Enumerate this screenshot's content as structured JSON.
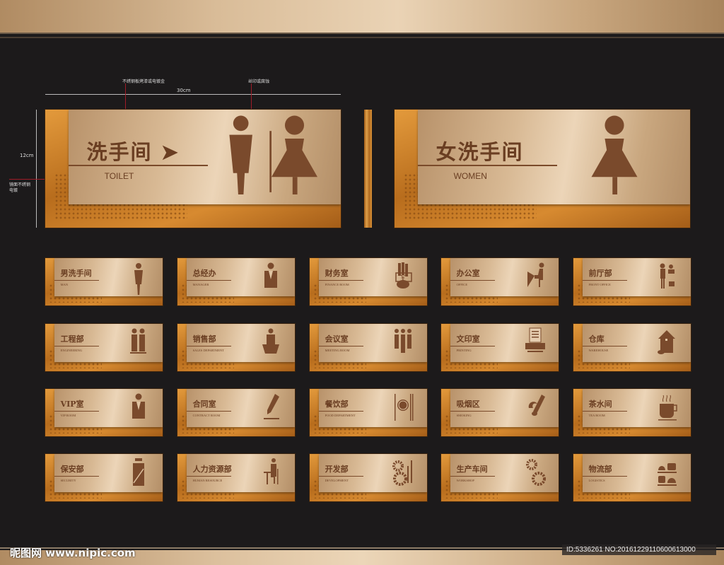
{
  "annotations": {
    "material": "不绣钢板烤漆或电镀金",
    "print": "丝印或腐蚀",
    "width": "30cm",
    "height": "12cm",
    "mirror": "镜面不绣钢电镀"
  },
  "large_signs": [
    {
      "cn": "洗手间 ➤",
      "en": "TOILET",
      "icon": "man-woman"
    },
    {
      "cn": "女洗手间",
      "en": "WOMEN",
      "icon": "woman"
    }
  ],
  "small_signs": [
    {
      "cn": "男洗手间",
      "en": "MAN",
      "icon": "man"
    },
    {
      "cn": "总经办",
      "en": "MANAGER",
      "icon": "manager"
    },
    {
      "cn": "财务室",
      "en": "FINANCE ROOM",
      "icon": "finance"
    },
    {
      "cn": "办公室",
      "en": "OFFICE",
      "icon": "office"
    },
    {
      "cn": "前厅部",
      "en": "FRONT OFFICE",
      "icon": "front"
    },
    {
      "cn": "工程部",
      "en": "ENGINEERING",
      "icon": "engineering"
    },
    {
      "cn": "销售部",
      "en": "SALES DEPARTMENT",
      "icon": "sales"
    },
    {
      "cn": "会议室",
      "en": "MEETING ROOM",
      "icon": "meeting"
    },
    {
      "cn": "文印室",
      "en": "PRINTING",
      "icon": "printer"
    },
    {
      "cn": "仓库",
      "en": "WAREHOUSE",
      "icon": "house"
    },
    {
      "cn": "VIP室",
      "en": "VIP ROOM",
      "icon": "manager"
    },
    {
      "cn": "合同室",
      "en": "CONTRACT ROOM",
      "icon": "pencil"
    },
    {
      "cn": "餐饮部",
      "en": "FOOD DEPARTMENT",
      "icon": "food"
    },
    {
      "cn": "吸烟区",
      "en": "SMOKING",
      "icon": "smoking"
    },
    {
      "cn": "茶水间",
      "en": "TEA ROOM",
      "icon": "cup"
    },
    {
      "cn": "保安部",
      "en": "SECURITY",
      "icon": "security"
    },
    {
      "cn": "人力资源部",
      "en": "HUMAN RESOURCE",
      "icon": "desk"
    },
    {
      "cn": "开发部",
      "en": "DEVELOPMENT",
      "icon": "gears-tools"
    },
    {
      "cn": "生产车间",
      "en": "WORKSHOP",
      "icon": "gears"
    },
    {
      "cn": "物流部",
      "en": "LOGISTICS",
      "icon": "logistics"
    }
  ],
  "footer": {
    "logo": "昵图网 www.nipic.com",
    "id": "ID:5336261 NO:20161229110600613000"
  },
  "colors": {
    "ink": "#6a3e22",
    "icon": "#7a4a2c",
    "bg": "#1c1a1b"
  }
}
